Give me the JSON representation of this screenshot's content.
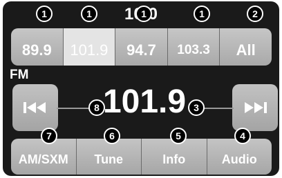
{
  "header": {
    "clock": "10:0"
  },
  "presets": [
    {
      "label": "89.9",
      "active": false
    },
    {
      "label": "101.9",
      "active": true
    },
    {
      "label": "94.7",
      "active": false
    },
    {
      "label": "103.3",
      "active": false
    },
    {
      "label": "All",
      "active": false
    }
  ],
  "tuner": {
    "band": "FM",
    "frequency": "101.9",
    "seek_down_icon": "seek-back-icon",
    "seek_up_icon": "seek-forward-icon"
  },
  "functions": [
    {
      "label": "AM/SXM"
    },
    {
      "label": "Tune"
    },
    {
      "label": "Info"
    },
    {
      "label": "Audio"
    }
  ],
  "callouts": [
    "1",
    "1",
    "1",
    "1",
    "2",
    "3",
    "4",
    "5",
    "6",
    "7",
    "8"
  ]
}
